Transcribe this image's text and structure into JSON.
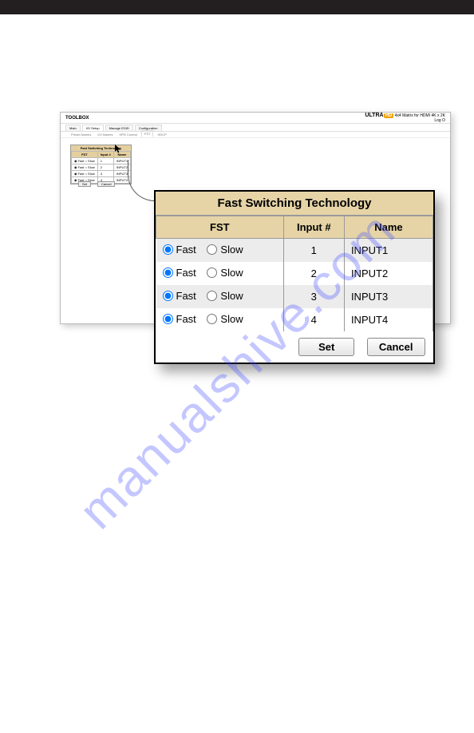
{
  "watermark": "manualshive.com",
  "bg": {
    "toolbox": "TOOLBOX",
    "product": "4x4 Matrix for HDMI 4K x 2K",
    "logout": "Log O",
    "ultra_text": "ULTRA",
    "hd": "HD",
    "tabs": [
      "Main",
      "I/O Setup",
      "Manage EDID",
      "Configuration"
    ],
    "active_tab": 1,
    "subtabs": [
      "Preset Names",
      "I/O Names",
      "HPD Control",
      "FST",
      "HDCP"
    ],
    "active_subtab": 3,
    "mini_title": "Fast Switching Technology",
    "mini_headers": [
      "FST",
      "Input #",
      "Name"
    ],
    "mini_rows": [
      {
        "fast": "Fast",
        "slow": "Slow",
        "idx": "1",
        "name": "INPUT1"
      },
      {
        "fast": "Fast",
        "slow": "Slow",
        "idx": "2",
        "name": "INPUT2"
      },
      {
        "fast": "Fast",
        "slow": "Slow",
        "idx": "3",
        "name": "INPUT3"
      },
      {
        "fast": "Fast",
        "slow": "Slow",
        "idx": "4",
        "name": "INPUT4"
      }
    ],
    "mini_set": "Set",
    "mini_cancel": "Cancel"
  },
  "panel": {
    "title": "Fast Switching Technology",
    "col_fst": "FST",
    "col_input": "Input #",
    "col_name": "Name",
    "rows": [
      {
        "fast": "Fast",
        "slow": "Slow",
        "idx": "1",
        "name": "INPUT1"
      },
      {
        "fast": "Fast",
        "slow": "Slow",
        "idx": "2",
        "name": "INPUT2"
      },
      {
        "fast": "Fast",
        "slow": "Slow",
        "idx": "3",
        "name": "INPUT3"
      },
      {
        "fast": "Fast",
        "slow": "Slow",
        "idx": "4",
        "name": "INPUT4"
      }
    ],
    "set_label": "Set",
    "cancel_label": "Cancel"
  }
}
